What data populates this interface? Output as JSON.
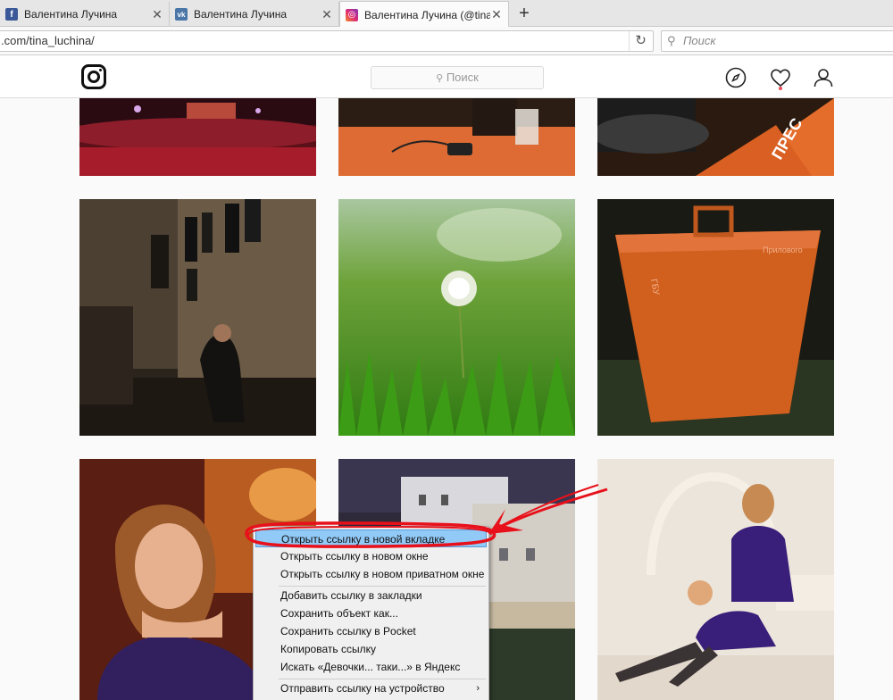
{
  "browser": {
    "tabs": [
      {
        "title": "Валентина Лучина",
        "favicon": "facebook-icon",
        "color": "#3b5998"
      },
      {
        "title": "Валентина Лучина",
        "favicon": "vk-icon",
        "color": "#4a76a8"
      },
      {
        "title": "Валентина Лучина (@tina_l",
        "favicon": "instagram-icon",
        "color": "#c13584"
      }
    ],
    "new_tab": "+",
    "close_glyph": "✕",
    "url": ".com/tina_luchina/",
    "reload_glyph": "↻",
    "search_placeholder": "Поиск"
  },
  "instagram": {
    "search_placeholder": "Поиск",
    "nav_icons": [
      "compass-icon",
      "heart-icon",
      "profile-icon"
    ],
    "notification_color": "#ed4956"
  },
  "context_menu": {
    "items": [
      {
        "label": "Открыть ссылку в новой вкладке",
        "highlighted": true
      },
      {
        "label": "Открыть ссылку в новом окне"
      },
      {
        "label": "Открыть ссылку в новом приватном окне"
      },
      {
        "label": "Добавить ссылку в закладки"
      },
      {
        "label": "Сохранить объект как..."
      },
      {
        "label": "Сохранить ссылку в Pocket"
      },
      {
        "label": "Копировать ссылку"
      },
      {
        "label": "Искать «Девочки... таки...» в Яндекс"
      },
      {
        "label": "Отправить ссылку на устройство",
        "submenu": "›"
      }
    ]
  },
  "annotation_color": "#e8101a"
}
